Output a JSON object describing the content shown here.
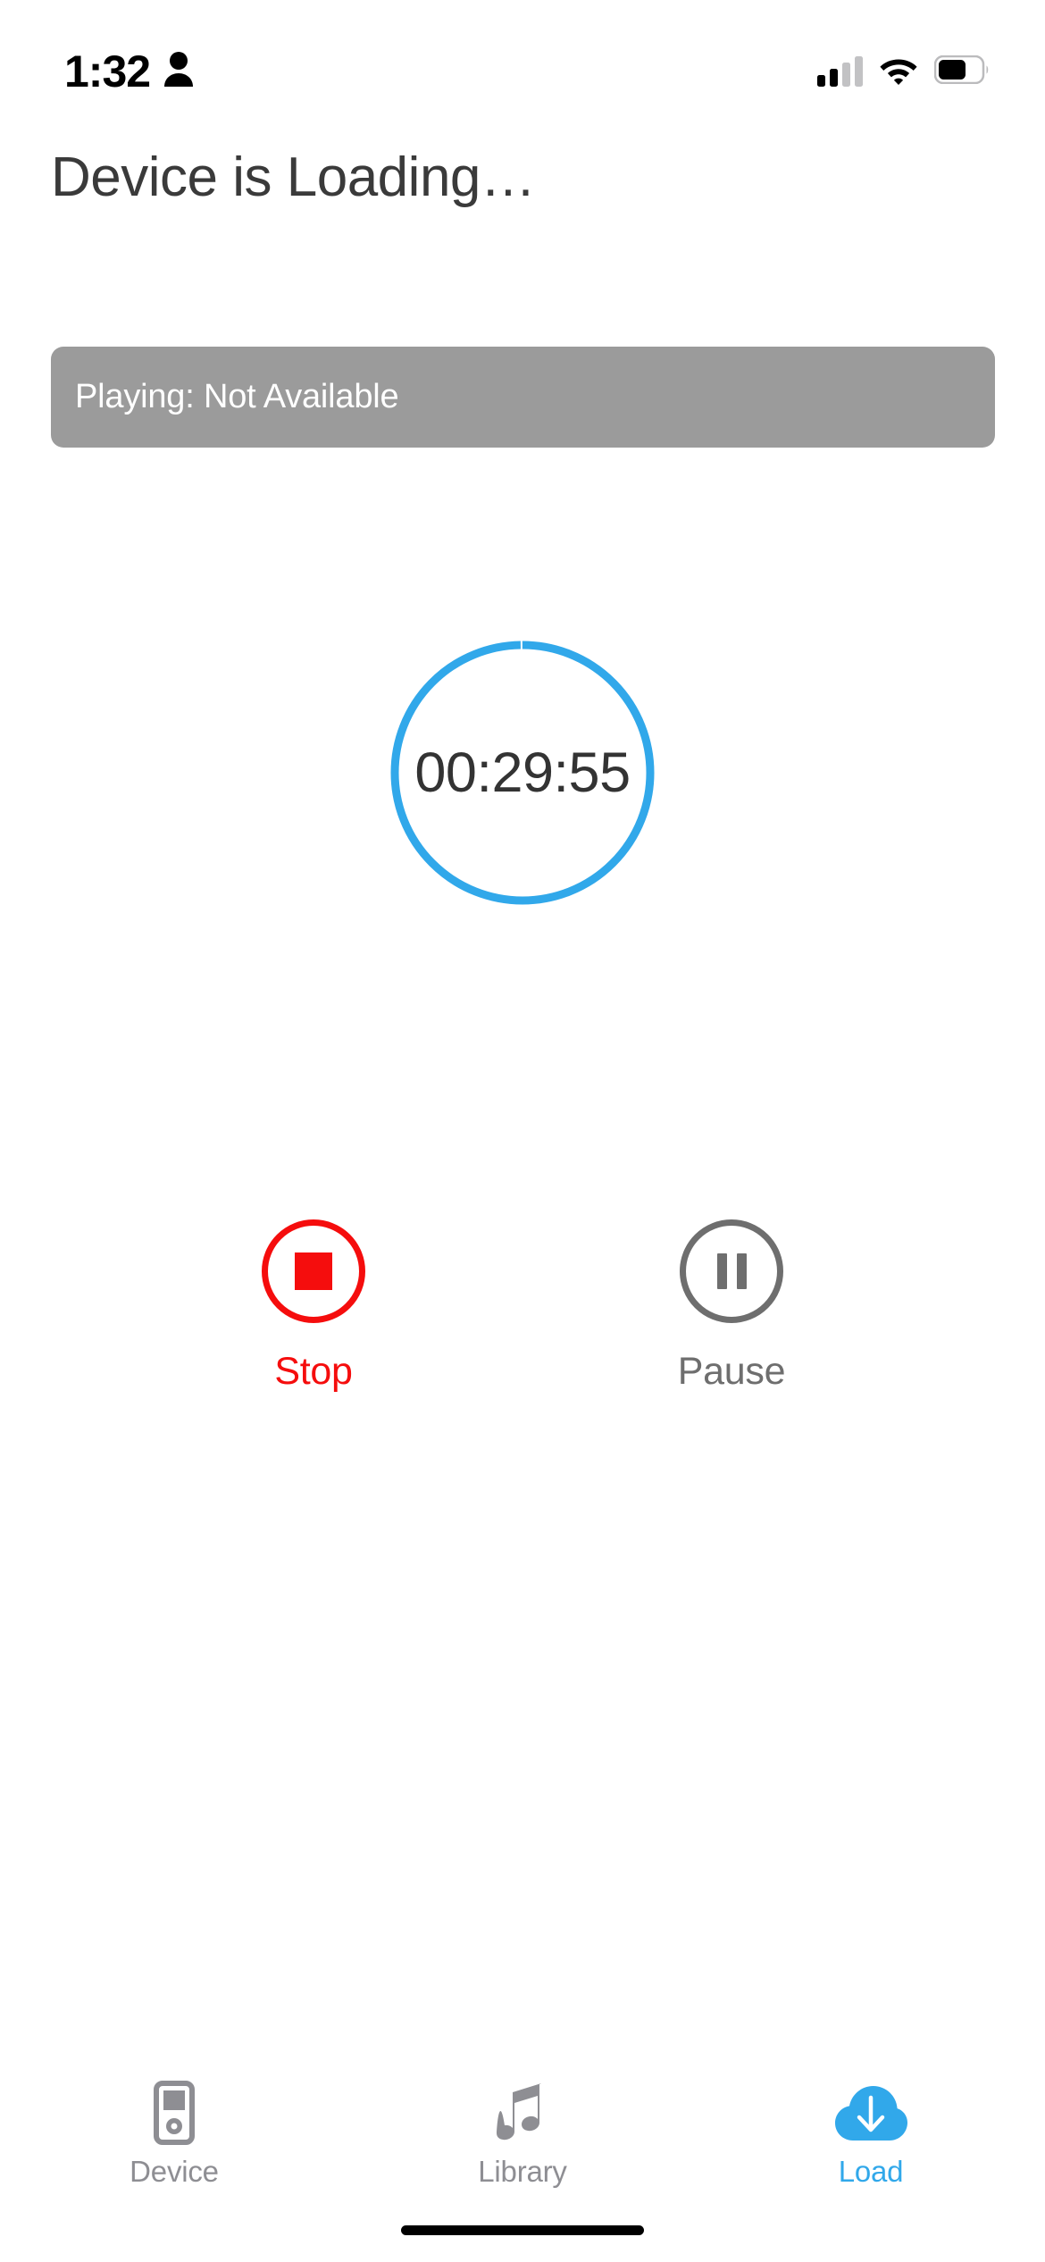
{
  "status_bar": {
    "time": "1:32",
    "person_icon": "person-icon",
    "signal_icon": "cellular-signal-icon",
    "wifi_icon": "wifi-icon",
    "battery_icon": "battery-icon"
  },
  "header": {
    "title": "Device is Loading…"
  },
  "now_playing": {
    "text": "Playing: Not Available",
    "background_color": "#9b9b9b",
    "text_color": "#ffffff"
  },
  "timer": {
    "value": "00:29:55",
    "ring_color": "#31a8ea",
    "track_color": "#ffffff",
    "progress_percent": 100,
    "text_color": "#333333"
  },
  "controls": [
    {
      "name": "stop",
      "label": "Stop",
      "icon": "stop-square-icon",
      "color": "#f50d0d"
    },
    {
      "name": "pause",
      "label": "Pause",
      "icon": "pause-bars-icon",
      "color": "#6e6e6e"
    }
  ],
  "tab_bar": {
    "active_color": "#31a8ea",
    "inactive_color": "#8e8e93",
    "tabs": [
      {
        "label": "Device",
        "icon": "ipod-device-icon",
        "active": false
      },
      {
        "label": "Library",
        "icon": "music-note-icon",
        "active": false
      },
      {
        "label": "Load",
        "icon": "cloud-download-icon",
        "active": true
      }
    ]
  }
}
